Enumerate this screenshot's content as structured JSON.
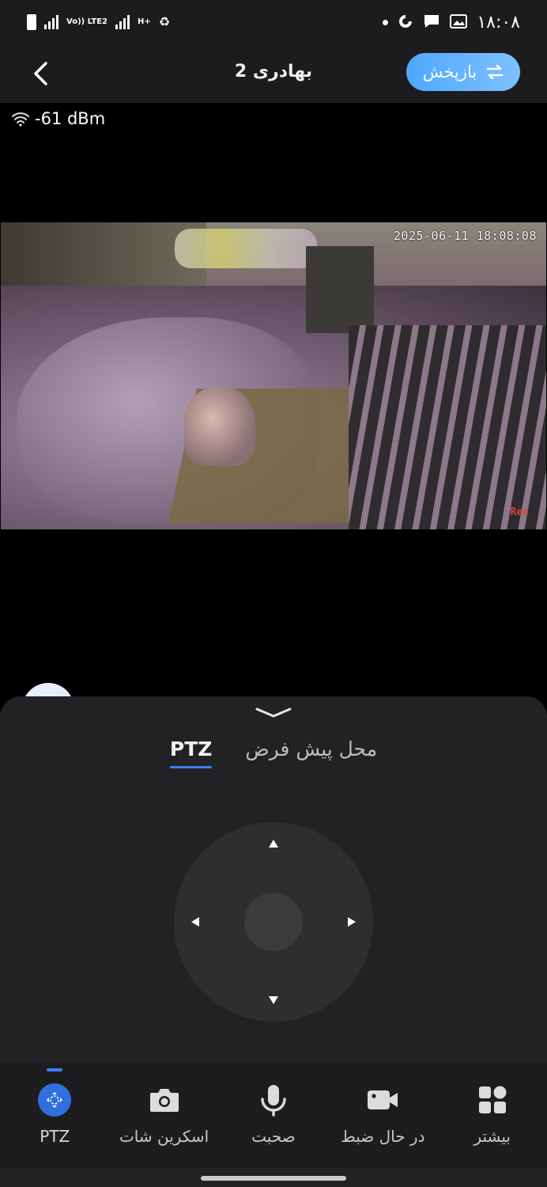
{
  "status_bar": {
    "network_1": "Vo)) LTE2",
    "network_2": "H+",
    "time": "۱۸:۰۸"
  },
  "header": {
    "title": "بهادری 2",
    "playback_label": "بازپخش"
  },
  "video": {
    "signal_strength": "-61 dBm",
    "timestamp": "2025-06-11 18:08:08",
    "rec_label": "Rec"
  },
  "sheet": {
    "tabs": [
      {
        "label": "PTZ",
        "active": true
      },
      {
        "label": "محل پیش فرض",
        "active": false
      }
    ]
  },
  "toolbar": {
    "items": [
      {
        "label": "PTZ",
        "icon": "ptz-icon",
        "active": true
      },
      {
        "label": "اسکرین شات",
        "icon": "camera-icon",
        "active": false
      },
      {
        "label": "صحبت",
        "icon": "microphone-icon",
        "active": false
      },
      {
        "label": "در حال ضبط",
        "icon": "video-record-icon",
        "active": false
      },
      {
        "label": "بیشتر",
        "icon": "grid-icon",
        "active": false
      }
    ]
  },
  "colors": {
    "accent": "#3b82f6",
    "playback_button": "#5aaeff",
    "background": "#222224"
  }
}
